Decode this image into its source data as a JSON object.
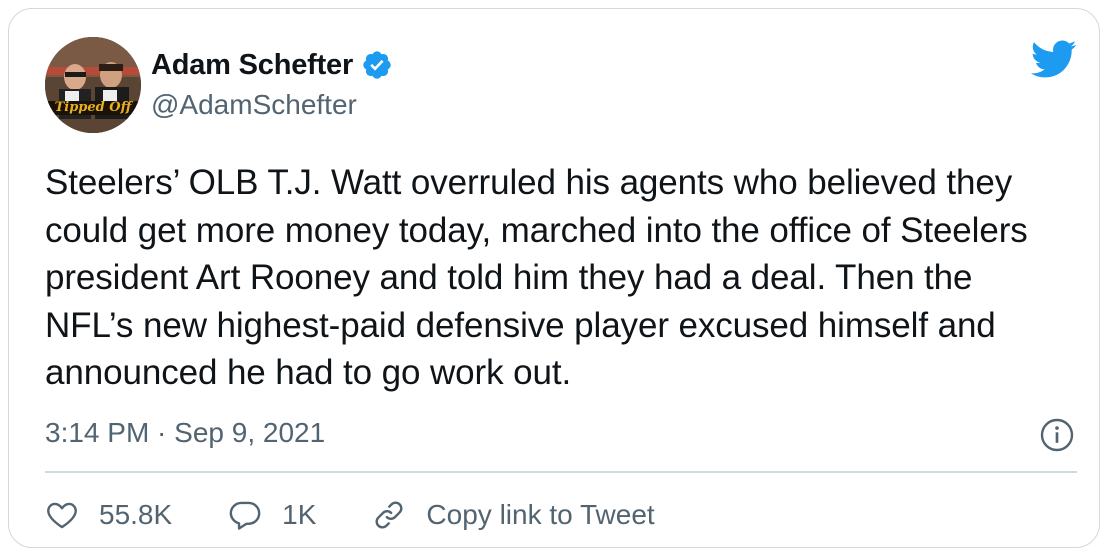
{
  "tweet": {
    "author": {
      "display_name": "Adam Schefter",
      "handle": "@AdamSchefter",
      "avatar_text": "Tipped Off",
      "verified": true
    },
    "text": "Steelers’ OLB T.J. Watt overruled his agents who believed they could get more money today, marched into the office of Steelers president Art Rooney and told him they had a deal. Then the NFL’s new highest-paid defensive player excused himself and announced he had to go work out.",
    "timestamp": "3:14 PM · Sep 9, 2021",
    "actions": {
      "likes": "55.8K",
      "replies": "1K",
      "copy_link_label": "Copy link to Tweet"
    }
  },
  "colors": {
    "primary_text": "#0f1419",
    "secondary_text": "#536471",
    "twitter_blue": "#1d9bf0",
    "border": "#cfd9de"
  },
  "icons": {
    "brand": "twitter-bird-icon",
    "verified": "verified-badge-icon",
    "info": "info-icon",
    "like": "heart-icon",
    "reply": "speech-bubble-icon",
    "copy_link": "link-icon"
  }
}
